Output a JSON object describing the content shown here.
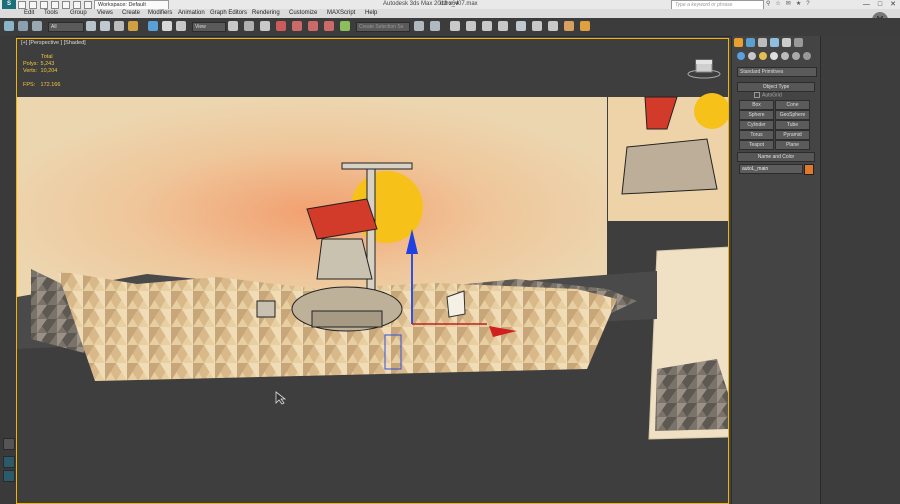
{
  "title_bar": {
    "app_title": "Autodesk 3ds Max  2013 x64",
    "file_name": "intro_v07.max",
    "workspace": "Workspace: Default",
    "search_placeholder": "Type a keyword or phrase",
    "logo_icon": "max-logo-icon",
    "minimize": "—",
    "maximize": "□",
    "close": "✕"
  },
  "menu": {
    "items": [
      "Edit",
      "Tools",
      "Group",
      "Views",
      "Create",
      "Modifiers",
      "Animation",
      "Graph Editors",
      "Rendering",
      "Customize",
      "MAXScript",
      "Help"
    ]
  },
  "toolbar": {
    "selection_filter": "All",
    "ref_coord": "View",
    "named_selection_placeholder": "Create Selection Se"
  },
  "viewport": {
    "label": "[+] [Perspective ] [Shaded]",
    "stats": {
      "header": "Total",
      "polys_label": "Polys:",
      "polys_value": "5,243",
      "verts_label": "Verts:",
      "verts_value": "10,204",
      "fps_label": "FPS:",
      "fps_value": "172.166"
    }
  },
  "command_panel": {
    "category_dropdown": "Standard Primitives",
    "object_type_title": "Object Type",
    "autogrid_label": "AutoGrid",
    "object_buttons": [
      "Box",
      "Cone",
      "Sphere",
      "GeoSphere",
      "Cylinder",
      "Tube",
      "Torus",
      "Pyramid",
      "Teapot",
      "Plane"
    ],
    "name_color_title": "Name and Color",
    "object_name": "autoL_main",
    "swatch_color": "#e07a2a"
  },
  "colors": {
    "accent_viewport_border": "#f2b400",
    "stats_text": "#f4c842"
  }
}
